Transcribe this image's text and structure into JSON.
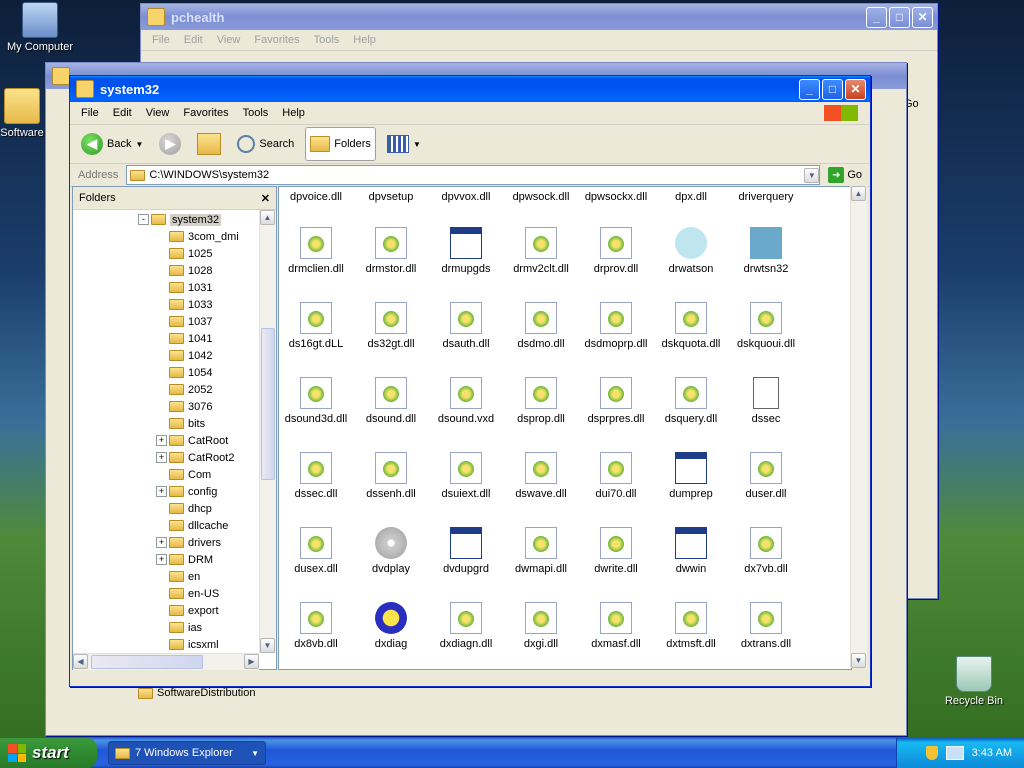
{
  "desktop": {
    "icons": [
      {
        "label": "My Computer"
      },
      {
        "label": "Software"
      },
      {
        "label": "Recycle Bin"
      }
    ]
  },
  "back_window_pchealth": {
    "title": "pchealth",
    "menu": [
      "File",
      "Edit",
      "View",
      "Favorites",
      "Tools",
      "Help"
    ],
    "go_label": "Go",
    "tree_item": "SoftwareDistribution"
  },
  "main_window": {
    "title": "system32",
    "menu": [
      "File",
      "Edit",
      "View",
      "Favorites",
      "Tools",
      "Help"
    ],
    "toolbar": {
      "back": "Back",
      "search": "Search",
      "folders": "Folders"
    },
    "address_label": "Address",
    "address_value": "C:\\WINDOWS\\system32",
    "go_label": "Go",
    "folders_pane_title": "Folders",
    "tree": [
      {
        "label": "system32",
        "selected": true,
        "expander": "-"
      },
      {
        "label": "3com_dmi"
      },
      {
        "label": "1025"
      },
      {
        "label": "1028"
      },
      {
        "label": "1031"
      },
      {
        "label": "1033"
      },
      {
        "label": "1037"
      },
      {
        "label": "1041"
      },
      {
        "label": "1042"
      },
      {
        "label": "1054"
      },
      {
        "label": "2052"
      },
      {
        "label": "3076"
      },
      {
        "label": "bits"
      },
      {
        "label": "CatRoot",
        "expander": "+"
      },
      {
        "label": "CatRoot2",
        "expander": "+"
      },
      {
        "label": "Com"
      },
      {
        "label": "config",
        "expander": "+"
      },
      {
        "label": "dhcp"
      },
      {
        "label": "dllcache"
      },
      {
        "label": "drivers",
        "expander": "+"
      },
      {
        "label": "DRM",
        "expander": "+"
      },
      {
        "label": "en"
      },
      {
        "label": "en-US"
      },
      {
        "label": "export"
      },
      {
        "label": "ias"
      },
      {
        "label": "icsxml"
      }
    ],
    "files": [
      [
        "dpvoice.dll",
        "dpvsetup",
        "dpvvox.dll",
        "dpwsock.dll",
        "dpwsockx.dll",
        "dpx.dll",
        "driverquery"
      ],
      [
        "drmclien.dll",
        "drmstor.dll",
        "drmupgds",
        "drmv2clt.dll",
        "drprov.dll",
        "drwatson",
        "drwtsn32"
      ],
      [
        "ds16gt.dLL",
        "ds32gt.dll",
        "dsauth.dll",
        "dsdmo.dll",
        "dsdmoprp.dll",
        "dskquota.dll",
        "dskquoui.dll"
      ],
      [
        "dsound3d.dll",
        "dsound.dll",
        "dsound.vxd",
        "dsprop.dll",
        "dsprpres.dll",
        "dsquery.dll",
        "dssec"
      ],
      [
        "dssec.dll",
        "dssenh.dll",
        "dsuiext.dll",
        "dswave.dll",
        "dui70.dll",
        "dumprep",
        "duser.dll"
      ],
      [
        "dusex.dll",
        "dvdplay",
        "dvdupgrd",
        "dwmapi.dll",
        "dwrite.dll",
        "dwwin",
        "dx7vb.dll"
      ],
      [
        "dx8vb.dll",
        "dxdiag",
        "dxdiagn.dll",
        "dxgi.dll",
        "dxmasf.dll",
        "dxtmsft.dll",
        "dxtrans.dll"
      ]
    ],
    "file_icons": [
      [
        "none",
        "none",
        "none",
        "none",
        "none",
        "none",
        "none"
      ],
      [
        "dll",
        "dll",
        "exe",
        "dll",
        "dll",
        "watson",
        "watson32"
      ],
      [
        "dll",
        "dll",
        "dll",
        "dll",
        "dll",
        "dll",
        "dll"
      ],
      [
        "dll",
        "dll",
        "dll",
        "dll",
        "dll",
        "dll",
        "doc"
      ],
      [
        "dll",
        "dll",
        "dll",
        "dll",
        "dll",
        "exe",
        "dll"
      ],
      [
        "dll",
        "dvd",
        "exe",
        "dll",
        "dll",
        "exe",
        "dll"
      ],
      [
        "dll",
        "xdiag",
        "dll",
        "dll",
        "dll",
        "dll",
        "dll"
      ]
    ]
  },
  "taskbar": {
    "start_label": "start",
    "task_label": "7 Windows Explorer",
    "clock": "3:43 AM"
  },
  "colors": {
    "title_active": "#0055ea",
    "taskbar": "#245edb",
    "start_green": "#3c9a3c"
  }
}
